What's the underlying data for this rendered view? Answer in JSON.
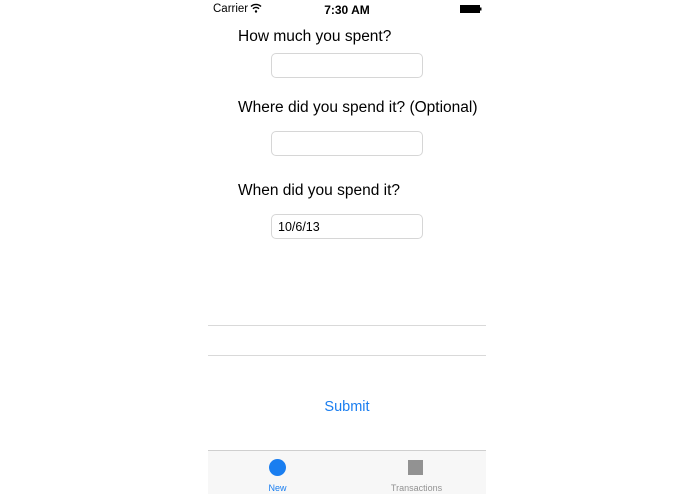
{
  "status_bar": {
    "carrier": "Carrier",
    "time": "7:30 AM"
  },
  "form": {
    "amount_label": "How much you spent?",
    "amount_value": "",
    "location_label": "Where did you spend it? (Optional)",
    "location_value": "",
    "date_label": "When did you spend it?",
    "date_value": "10/6/13",
    "submit_label": "Submit"
  },
  "tab_bar": {
    "tabs": [
      {
        "label": "New",
        "icon": "circle-icon",
        "selected": true
      },
      {
        "label": "Transactions",
        "icon": "square-icon",
        "selected": false
      }
    ]
  },
  "colors": {
    "accent": "#1a7ef0",
    "inactive": "#929292"
  }
}
